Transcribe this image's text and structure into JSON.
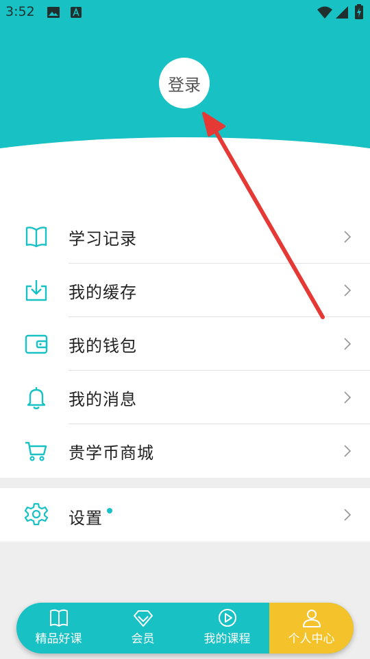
{
  "status_bar": {
    "time": "3:52"
  },
  "header": {
    "login_label": "登录"
  },
  "menu": {
    "items": [
      {
        "label": "学习记录",
        "icon": "book-icon"
      },
      {
        "label": "我的缓存",
        "icon": "download-icon"
      },
      {
        "label": "我的钱包",
        "icon": "wallet-icon"
      },
      {
        "label": "我的消息",
        "icon": "bell-icon"
      },
      {
        "label": "贵学币商城",
        "icon": "cart-icon"
      }
    ],
    "settings": {
      "label": "设置",
      "icon": "gear-icon",
      "has_badge": true
    }
  },
  "tabbar": {
    "tabs": [
      {
        "label": "精品好课",
        "icon": "open-book-icon",
        "active": false
      },
      {
        "label": "会员",
        "icon": "diamond-icon",
        "active": false
      },
      {
        "label": "我的课程",
        "icon": "play-circle-icon",
        "active": false
      },
      {
        "label": "个人中心",
        "icon": "person-icon",
        "active": true
      }
    ]
  },
  "colors": {
    "accent": "#17c1c4",
    "active_tab": "#f4c22b",
    "arrow": "#e53935"
  }
}
